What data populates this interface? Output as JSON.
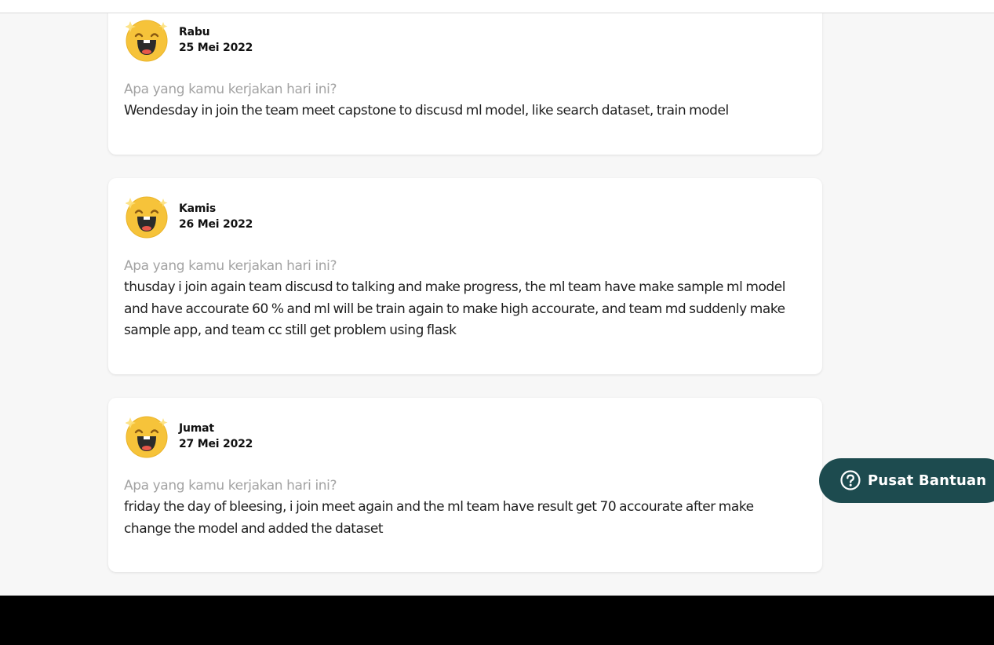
{
  "entries": [
    {
      "day": "Rabu",
      "date": "25 Mei 2022",
      "question": "Apa yang kamu kerjakan hari ini?",
      "answer": "Wendesday in join the team meet capstone to discusd ml model, like search dataset, train model"
    },
    {
      "day": "Kamis",
      "date": "26 Mei 2022",
      "question": "Apa yang kamu kerjakan hari ini?",
      "answer": "thusday i join again team discusd to talking and make progress, the ml team have make sample ml model and have accourate 60 % and ml will be train again to make high accourate, and team md suddenly make sample app, and team cc still get problem using flask"
    },
    {
      "day": "Jumat",
      "date": "27 Mei 2022",
      "question": "Apa yang kamu kerjakan hari ini?",
      "answer": "friday the day of bleesing, i join meet again and the ml team have result get 70 accourate after make change the model and added the dataset"
    }
  ],
  "mood_icon": "laughing-face-icon",
  "help": {
    "label": "Pusat Bantuan",
    "icon": "question-circle-icon"
  },
  "colors": {
    "accent": "#1d4b4f",
    "emoji_face": "#f6c33a",
    "question_text": "#a3a3a3",
    "footer": "#000000"
  }
}
